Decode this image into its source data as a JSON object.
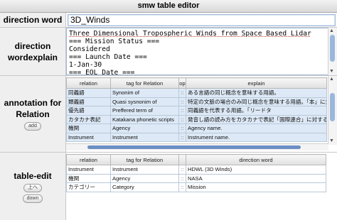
{
  "window": {
    "title": "smw table editor"
  },
  "direction_word": {
    "label": "direction word",
    "value": "3D_Winds"
  },
  "explain": {
    "label_line1": "direction",
    "label_line2": "wordexplain",
    "lines": [
      "Three Dimensional Tropospheric Winds from Space Based Lidar",
      "=== Mission Status ===",
      "Considered",
      "=== Launch Date ===",
      "1-Jan-30",
      "=== EOL Date ==="
    ]
  },
  "annotation": {
    "label_line1": "annotation for",
    "label_line2": "Relation",
    "add_label": "add",
    "columns": [
      "relation",
      "tag for Relation",
      "op",
      "explain"
    ],
    "rows": [
      {
        "relation": "同義語",
        "tag": "Synonim of",
        "op": "::",
        "explain": "ある言語の同じ概念を意味する用語。"
      },
      {
        "relation": "類義語",
        "tag": "Quasi sysnonim of",
        "op": "::",
        "explain": "特定の文脈の場合のみ同じ概念を意味する用語。「本」に対する「書"
      },
      {
        "relation": "優先語",
        "tag": "Preffered term of",
        "op": "::",
        "explain": "同義語を代表する用語。「リードタ"
      },
      {
        "relation": "カタカナ表記",
        "tag": "Katakana phonetic scripts",
        "op": "::",
        "explain": "発音し語の読み方をカタカナで表記「国際連合」に対する「"
      },
      {
        "relation": "機関",
        "tag": "Agency",
        "op": "::",
        "explain": "Agency name."
      },
      {
        "relation": "Instrument",
        "tag": "Instrument",
        "op": "::",
        "explain": "Instrument name."
      }
    ]
  },
  "table_edit": {
    "label": "table-edit",
    "up_label": "上へ",
    "down_label": "down",
    "columns": [
      "relation",
      "tag for Relation",
      "",
      "direction word"
    ],
    "rows": [
      {
        "relation": "Instrument",
        "tag": "Instrument",
        "op": "::",
        "word": "HDWL (3D Winds)"
      },
      {
        "relation": "機関",
        "tag": "Agency",
        "op": "::",
        "word": "NASA"
      },
      {
        "relation": "カテゴリー",
        "tag": "Category",
        "op": "::",
        "word": "Mission"
      }
    ]
  }
}
